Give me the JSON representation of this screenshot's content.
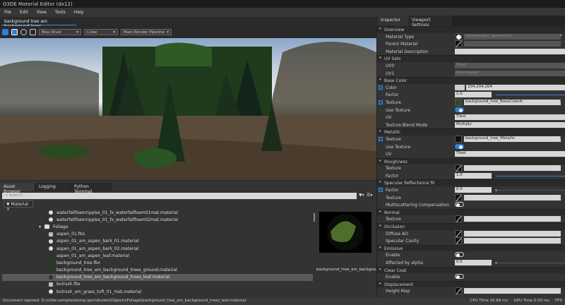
{
  "window": {
    "title": "O3DE Material Editor (dx12)"
  },
  "menu": [
    "File",
    "Edit",
    "View",
    "Tools",
    "Help"
  ],
  "document_tab": "background tree am background trees",
  "toolbar": {
    "lighting": "Blau River",
    "model": "Cube",
    "pipeline": "Main Render Pipeline"
  },
  "bottom": {
    "tabs": [
      "Asset Browser",
      "Logging",
      "Python Terminal"
    ],
    "search_placeholder": "Search...",
    "filter": "Material",
    "items": [
      {
        "name": "waterfallfoamripples_01_fx_waterfallfoam01mat.material",
        "icon": "material-icon",
        "indent": 1
      },
      {
        "name": "waterfallfoamripples_01_fx_waterfallfoam02mat.material",
        "icon": "material-icon",
        "indent": 1
      },
      {
        "name": "Foliage",
        "icon": "folder-icon",
        "indent": 0
      },
      {
        "name": "aspen_01.fbx",
        "icon": "fbx-icon",
        "indent": 1
      },
      {
        "name": "aspen_01_am_aspen_bark_01.material",
        "icon": "material-icon",
        "indent": 1
      },
      {
        "name": "aspen_01_am_aspen_bark_02.material",
        "icon": "material-icon",
        "indent": 1
      },
      {
        "name": "aspen_01_am_aspen_leaf.material",
        "icon": "material-icon",
        "indent": 1
      },
      {
        "name": "background_tree.fbx",
        "icon": "fbx-icon",
        "indent": 1
      },
      {
        "name": "background_tree_am_background_trees_ground.material",
        "icon": "material-icon",
        "indent": 1
      },
      {
        "name": "background_tree_am_background_trees_leaf.material",
        "icon": "material-icon",
        "indent": 1,
        "selected": true
      },
      {
        "name": "bulrush.fbx",
        "icon": "fbx-icon",
        "indent": 1
      },
      {
        "name": "bulrush_am_grass_tuft_01_mat.material",
        "icon": "material-icon",
        "indent": 1
      }
    ],
    "preview_label": "background_tree_am_background_trees_leaf.material"
  },
  "inspector": {
    "tabs": [
      "Inspector",
      "Viewport Settings"
    ],
    "groups": [
      {
        "title": "Overview",
        "rows": [
          {
            "label": "Material Type",
            "kind": "asset",
            "thumb": "white",
            "value": "standardpbr_generated",
            "disabled": true
          },
          {
            "label": "Parent Material",
            "kind": "asset",
            "thumb": "slash",
            "value": "",
            "disabled": true
          },
          {
            "label": "Material Description",
            "kind": "text",
            "value": ""
          }
        ]
      },
      {
        "title": "UV Sets",
        "rows": [
          {
            "label": "UV0",
            "kind": "text",
            "value": "Tiled",
            "disabled": true
          },
          {
            "label": "UV1",
            "kind": "text",
            "value": "Unwrapped",
            "disabled": true
          }
        ]
      },
      {
        "title": "Base Color",
        "rows": [
          {
            "label": "Color",
            "kind": "color",
            "value": "204,204,204",
            "overridden": true
          },
          {
            "label": "Factor",
            "kind": "slider",
            "value": "1.0",
            "fraction": 1
          },
          {
            "label": "Texture",
            "kind": "asset",
            "thumb": "tex",
            "value": "background_tree_BaseColorA",
            "overridden": true,
            "clear": true
          },
          {
            "label": "Use Texture",
            "kind": "toggle",
            "on": true
          },
          {
            "label": "UV",
            "kind": "combo",
            "value": "Tiled"
          },
          {
            "label": "Texture Blend Mode",
            "kind": "combo",
            "value": "Multiply"
          }
        ]
      },
      {
        "title": "Metallic",
        "rows": [
          {
            "label": "Texture",
            "kind": "asset",
            "thumb": "black",
            "value": "background_tree_Metallic",
            "overridden": true,
            "clear": true
          },
          {
            "label": "Use Texture",
            "kind": "toggle",
            "on": true
          },
          {
            "label": "UV",
            "kind": "combo",
            "value": "Tiled"
          }
        ]
      },
      {
        "title": "Roughness",
        "rows": [
          {
            "label": "Texture",
            "kind": "asset",
            "thumb": "slash",
            "value": ""
          },
          {
            "label": "Factor",
            "kind": "slider",
            "value": "1.0",
            "fraction": 1
          }
        ]
      },
      {
        "title": "Specular Reflectance f0",
        "rows": [
          {
            "label": "Factor",
            "kind": "slider",
            "value": "0.0",
            "fraction": 0,
            "overridden": true
          },
          {
            "label": "Texture",
            "kind": "asset",
            "thumb": "slash",
            "value": ""
          },
          {
            "label": "Multiscattering Compensation",
            "kind": "toggle",
            "on": false
          }
        ]
      },
      {
        "title": "Normal",
        "rows": [
          {
            "label": "Texture",
            "kind": "asset",
            "thumb": "slash",
            "value": ""
          }
        ]
      },
      {
        "title": "Occlusion",
        "rows": [
          {
            "label": "Diffuse AO",
            "kind": "asset",
            "thumb": "slash",
            "value": ""
          },
          {
            "label": "Specular Cavity",
            "kind": "asset",
            "thumb": "slash",
            "value": ""
          }
        ]
      },
      {
        "title": "Emissive",
        "rows": [
          {
            "label": "Enable",
            "kind": "toggle",
            "on": false
          },
          {
            "label": "Affected by alpha",
            "kind": "slider",
            "value": "0.0",
            "fraction": 0
          }
        ]
      },
      {
        "title": "Clear Coat",
        "rows": [
          {
            "label": "Enable",
            "kind": "toggle",
            "on": false
          }
        ]
      },
      {
        "title": "Displacement",
        "rows": [
          {
            "label": "Height Map",
            "kind": "asset",
            "thumb": "slash",
            "value": ""
          }
        ]
      }
    ]
  },
  "status": {
    "message": "Document opened: D:\\o3de-samples\\temp-gem\\Assets\\Objects\\Foliage\\background_tree_am_background_trees_leaf.material",
    "cpu": "CPU Time 16.68 ms",
    "gpu": "GPU Time 0.00 ms",
    "fps": "FPS"
  },
  "colors": {
    "accent": "#3a8bd8",
    "toggle_on": "#2f7ee0",
    "base_color_swatch": "#cccccc"
  }
}
